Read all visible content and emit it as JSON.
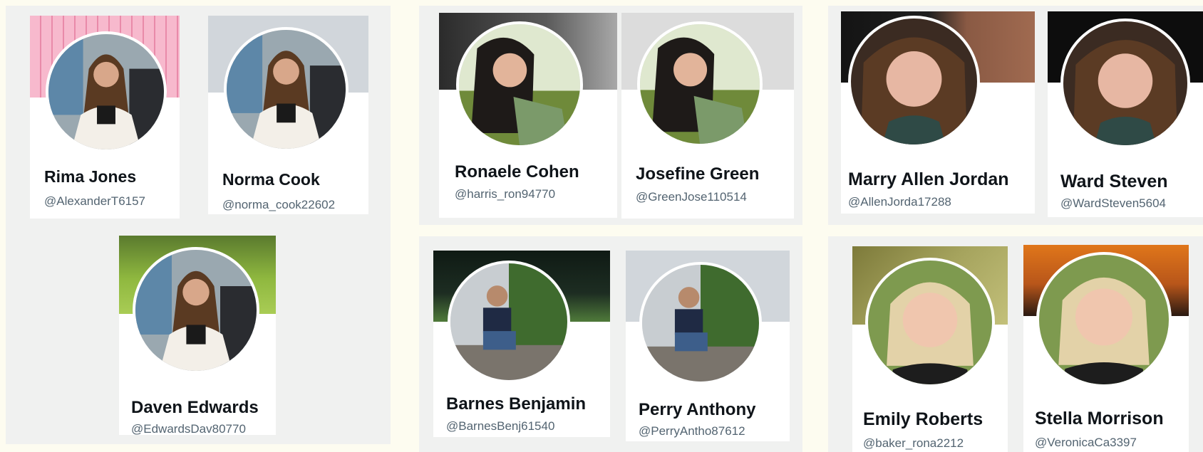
{
  "panels": [
    {
      "cards": [
        {
          "name": "Rima Jones",
          "handle": "@AlexanderT6157",
          "banner": "pink-stripes",
          "avatar": "woman-brown-hair-white-jacket"
        },
        {
          "name": "Norma Cook",
          "handle": "@norma_cook22602",
          "banner": "gray",
          "avatar": "woman-brown-hair-white-jacket"
        },
        {
          "name": "Daven Edwards",
          "handle": "@EdwardsDav80770",
          "banner": "green-foliage",
          "avatar": "woman-brown-hair-white-jacket"
        }
      ]
    },
    {
      "cards": [
        {
          "name": "Ronaele Cohen",
          "handle": "@harris_ron94770",
          "banner": "dark-gradient",
          "avatar": "woman-dark-hair-field"
        },
        {
          "name": "Josefine Green",
          "handle": "@GreenJose110514",
          "banner": "light-gray",
          "avatar": "woman-dark-hair-field"
        }
      ]
    },
    {
      "cards": [
        {
          "name": "Barnes Benjamin",
          "handle": "@BarnesBenj61540",
          "banner": "night-landscape",
          "avatar": "man-sitting-on-rock"
        },
        {
          "name": "Perry Anthony",
          "handle": "@PerryAntho87612",
          "banner": "gray",
          "avatar": "man-sitting-on-rock"
        }
      ]
    },
    {
      "cards": [
        {
          "name": "Marry Allen Jordan",
          "handle": "@AllenJorda17288",
          "banner": "dark-portrait-closeup",
          "avatar": "woman-curly-hair-wink"
        },
        {
          "name": "Ward Steven",
          "handle": "@WardSteven5604",
          "banner": "black",
          "avatar": "woman-curly-hair-wink"
        }
      ]
    },
    {
      "cards": [
        {
          "name": "Emily Roberts",
          "handle": "@baker_rona2212",
          "banner": "olive-texture",
          "avatar": "blonde-woman-smiling"
        },
        {
          "name": "Stella Morrison",
          "handle": "@VeronicaCa3397",
          "banner": "orange-sunset",
          "avatar": "blonde-woman-smiling"
        }
      ]
    }
  ]
}
